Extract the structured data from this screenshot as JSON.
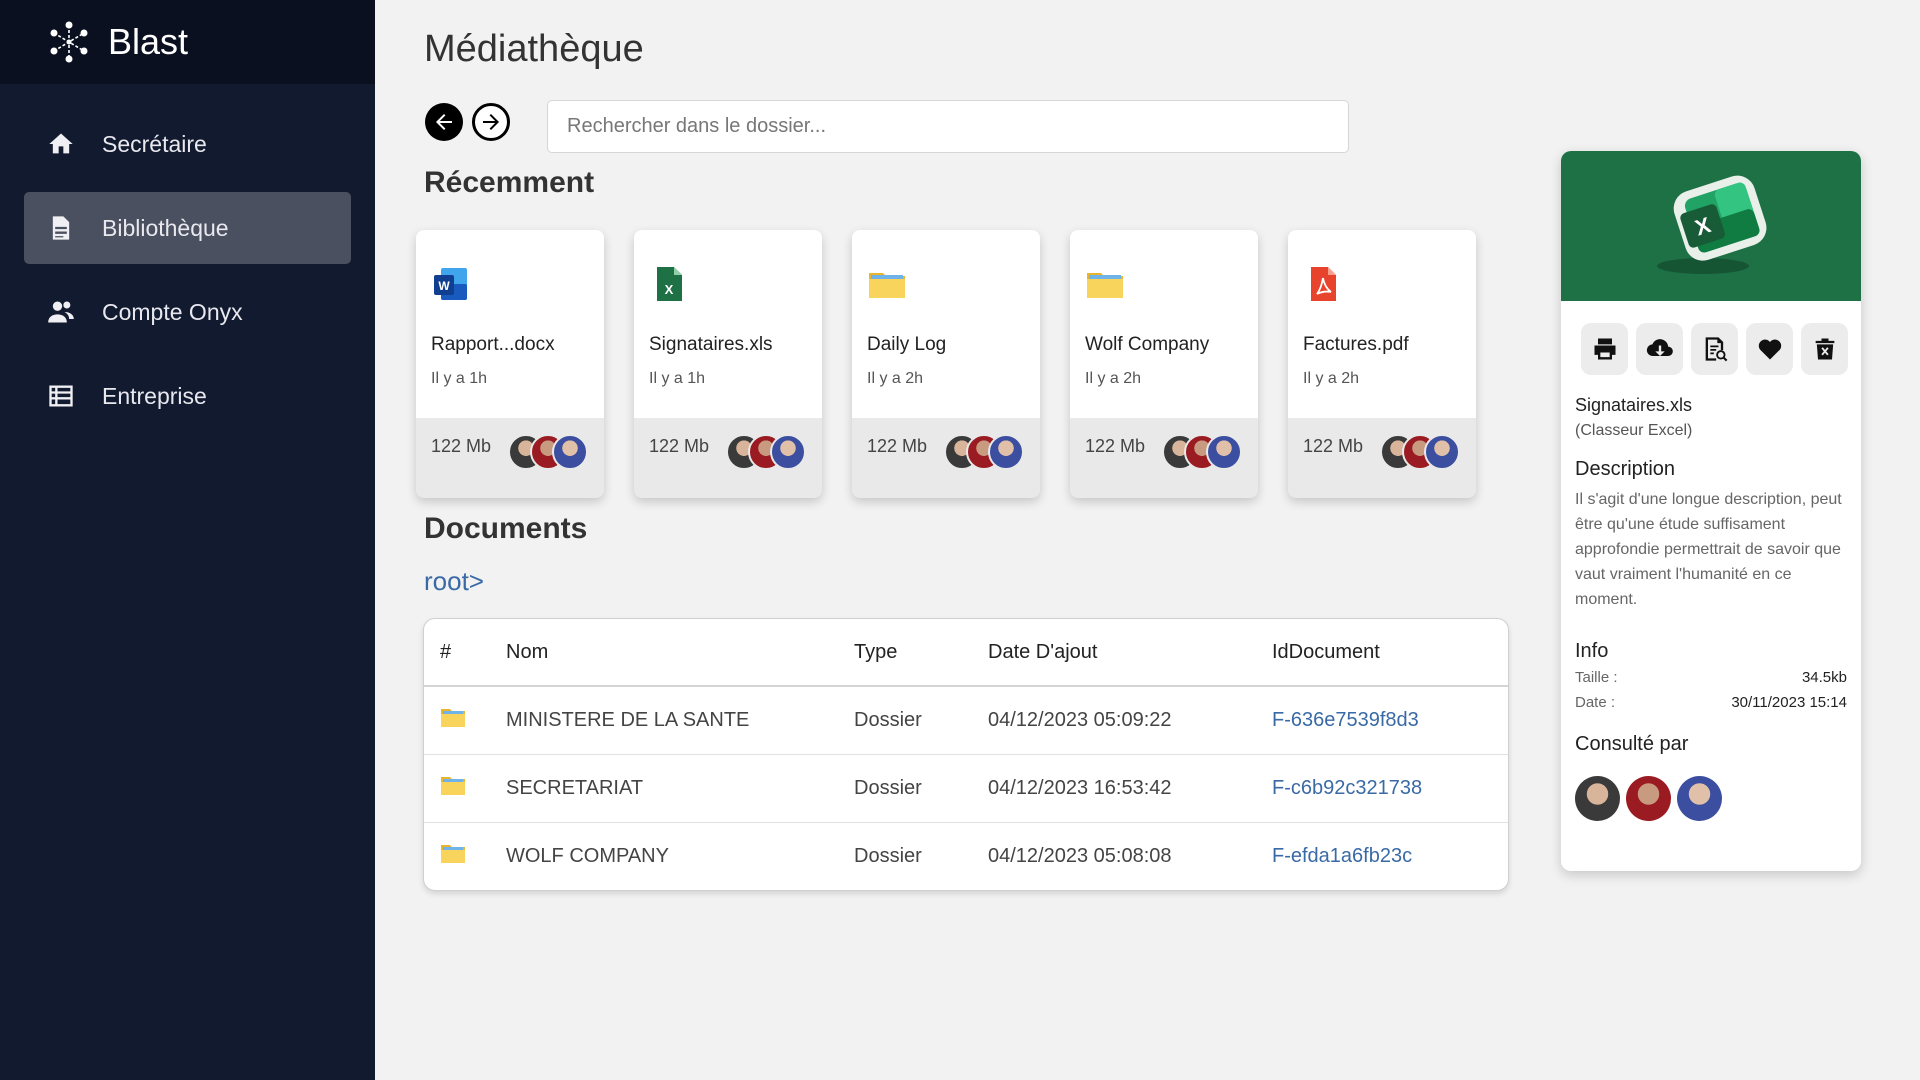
{
  "app": {
    "name": "Blast"
  },
  "sidebar": {
    "items": [
      {
        "label": "Secrétaire",
        "icon": "home-icon",
        "active": false
      },
      {
        "label": "Bibliothèque",
        "icon": "document-icon",
        "active": true
      },
      {
        "label": "Compte Onyx",
        "icon": "users-icon",
        "active": false
      },
      {
        "label": "Entreprise",
        "icon": "table-icon",
        "active": false
      }
    ]
  },
  "main": {
    "title": "Médiathèque",
    "search": {
      "placeholder": "Rechercher dans le dossier...",
      "value": ""
    },
    "recent_title": "Récemment",
    "recent": [
      {
        "name": "Rapport...docx",
        "time": "Il y a 1h",
        "size": "122 Mb",
        "icon": "word-icon"
      },
      {
        "name": "Signataires.xls",
        "time": "Il y a 1h",
        "size": "122 Mb",
        "icon": "excel-icon"
      },
      {
        "name": "Daily Log",
        "time": "Il y a 2h",
        "size": "122 Mb",
        "icon": "folder-icon"
      },
      {
        "name": "Wolf Company",
        "time": "Il y a 2h",
        "size": "122 Mb",
        "icon": "folder-icon"
      },
      {
        "name": "Factures.pdf",
        "time": "Il y a 2h",
        "size": "122 Mb",
        "icon": "pdf-icon"
      }
    ],
    "documents_title": "Documents",
    "breadcrumb": "root>",
    "table": {
      "headers": [
        "#",
        "Nom",
        "Type",
        "Date D'ajout",
        "IdDocument"
      ],
      "rows": [
        {
          "name": "MINISTERE DE LA SANTE",
          "type": "Dossier",
          "date": "04/12/2023 05:09:22",
          "id": "F-636e7539f8d3"
        },
        {
          "name": "SECRETARIAT",
          "type": "Dossier",
          "date": "04/12/2023 16:53:42",
          "id": "F-c6b92c321738"
        },
        {
          "name": "WOLF COMPANY",
          "type": "Dossier",
          "date": "04/12/2023 05:08:08",
          "id": "F-efda1a6fb23c"
        }
      ]
    }
  },
  "panel": {
    "file_name": "Signataires.xls",
    "file_type": "(Classeur Excel)",
    "description_title": "Description",
    "description": "Il s'agit d'une longue description, peut être qu'une étude suffisament approfondie permettrait de savoir que vaut vraiment l'humanité en ce moment.",
    "info_title": "Info",
    "info": [
      {
        "key": "Taille :",
        "value": "34.5kb"
      },
      {
        "key": "Date :",
        "value": "30/11/2023 15:14"
      }
    ],
    "consulted_title": "Consulté par",
    "actions": [
      "print-icon",
      "download-icon",
      "preview-icon",
      "heart-icon",
      "delete-icon"
    ]
  },
  "colors": {
    "sidebar_bg": "#121a30",
    "active_item": "#4a5060",
    "link": "#3a6aa5",
    "excel_green": "#1e7145"
  }
}
